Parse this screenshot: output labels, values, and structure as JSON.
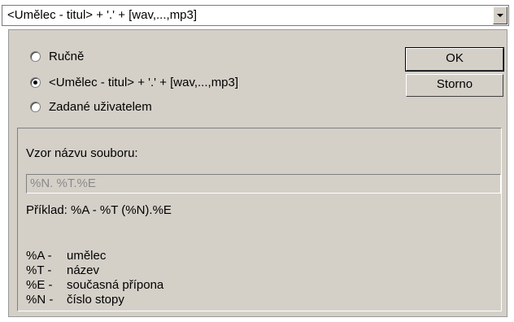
{
  "combo": {
    "value": "<Umělec - titul> + '.' + [wav,...,mp3]"
  },
  "options": [
    {
      "label": "Ručně",
      "selected": false
    },
    {
      "label": "<Umělec - titul> + '.' + [wav,...,mp3]",
      "selected": true
    },
    {
      "label": "Zadané uživatelem",
      "selected": false
    }
  ],
  "buttons": {
    "ok": "OK",
    "cancel": "Storno"
  },
  "pattern": {
    "label": "Vzor názvu souboru:",
    "value": "%N. %T.%E",
    "example": "Příklad: %A - %T (%N).%E"
  },
  "legend": [
    {
      "code": "%A -",
      "desc": "umělec"
    },
    {
      "code": "%T -",
      "desc": "název"
    },
    {
      "code": "%E -",
      "desc": "současná přípona"
    },
    {
      "code": "%N -",
      "desc": "číslo stopy"
    }
  ],
  "colors": {
    "dialog_bg": "#d4d0c8",
    "disabled_text": "#8a8a8a"
  }
}
